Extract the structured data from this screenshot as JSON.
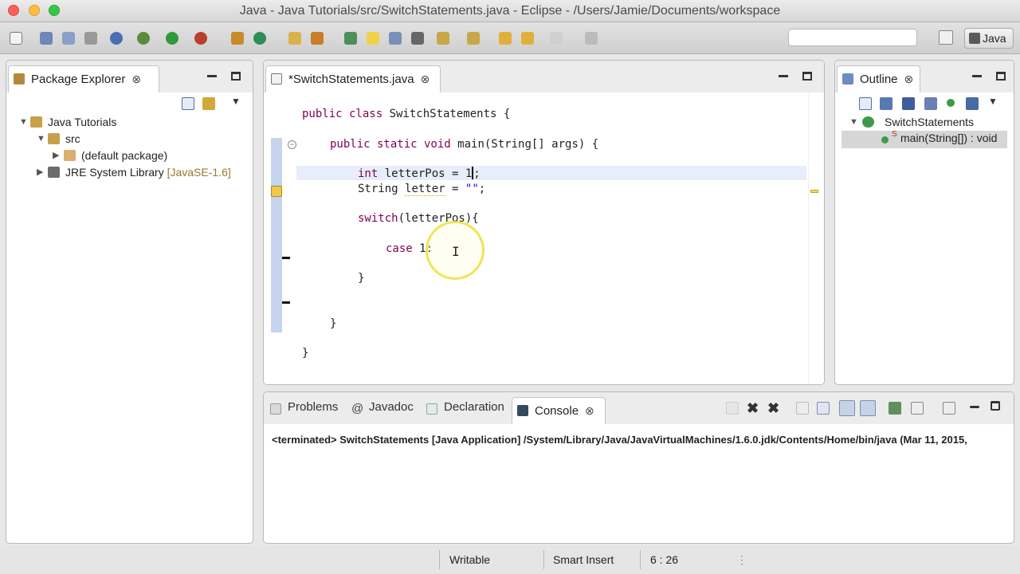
{
  "window": {
    "title": "Java - Java Tutorials/src/SwitchStatements.java - Eclipse - /Users/Jamie/Documents/workspace"
  },
  "toolbar": {
    "perspective_label": "Java",
    "search_placeholder": ""
  },
  "package_explorer": {
    "tab_label": "Package Explorer",
    "close_glyph": "⊗",
    "tree": [
      {
        "label": "Java Tutorials",
        "qualifier": ""
      },
      {
        "label": "src",
        "qualifier": ""
      },
      {
        "label": "(default package)",
        "qualifier": ""
      },
      {
        "label": "JRE System Library",
        "qualifier": "[JavaSE-1.6]"
      }
    ]
  },
  "editor": {
    "tab_label": "*SwitchStatements.java",
    "close_glyph": "⊗",
    "code": {
      "l1_kw": "public class ",
      "l1_rest": "SwitchStatements {",
      "l2_kw": "public static void ",
      "l2_rest": "main(String[] args) {",
      "l3_kw": "int ",
      "l3_rest": "letterPos = 1",
      "l3_end": ";",
      "l4_a": "String ",
      "l4_var": "letter",
      "l4_b": " = ",
      "l4_str": "\"\"",
      "l4_c": ";",
      "l5_kw": "switch",
      "l5_rest": "(letterPos){",
      "l6_kw": "case ",
      "l6_rest": "1:",
      "l7": "}",
      "l8": "}",
      "l9": "}"
    }
  },
  "outline": {
    "tab_label": "Outline",
    "close_glyph": "⊗",
    "class_name": "SwitchStatements",
    "method_sig": "main(String[]) : void",
    "static_marker": "S"
  },
  "bottom": {
    "tabs": [
      {
        "label": "Problems"
      },
      {
        "label": "Javadoc"
      },
      {
        "label": "Declaration"
      },
      {
        "label": "Console"
      }
    ],
    "console_close": "⊗",
    "console_line": "<terminated> SwitchStatements [Java Application] /System/Library/Java/JavaVirtualMachines/1.6.0.jdk/Contents/Home/bin/java (Mar 11, 2015,"
  },
  "status": {
    "writable": "Writable",
    "insert_mode": "Smart Insert",
    "position": "6 : 26",
    "more_glyph": "⋮"
  },
  "colors": {
    "keyword": "#7f0055",
    "string": "#2a00ff",
    "current_line": "#e8edfa",
    "fold_bar": "#c7d4ee"
  }
}
